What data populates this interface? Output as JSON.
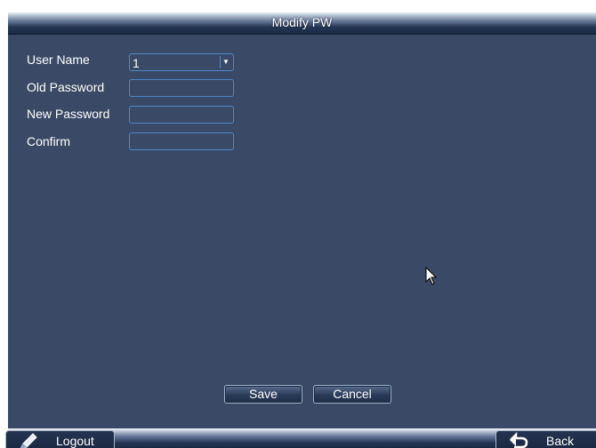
{
  "window": {
    "title": "Modify PW"
  },
  "form": {
    "user_name": {
      "label": "User Name",
      "value": "1"
    },
    "old_password": {
      "label": "Old Password",
      "value": ""
    },
    "new_password": {
      "label": "New Password",
      "value": ""
    },
    "confirm": {
      "label": "Confirm",
      "value": ""
    }
  },
  "buttons": {
    "save_label": "Save",
    "cancel_label": "Cancel"
  },
  "bottom_bar": {
    "logout_label": "Logout",
    "logout_icon": "pen-icon",
    "back_label": "Back",
    "back_icon": "return-arrow-icon"
  },
  "colors": {
    "window_background": "#3a4a66",
    "field_border": "#4f86c9",
    "text": "#ffffff"
  }
}
